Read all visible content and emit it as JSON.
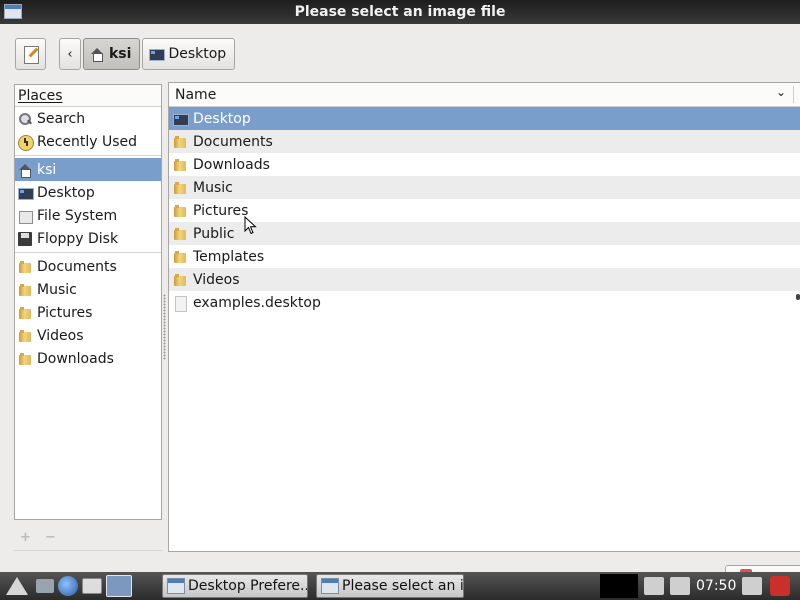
{
  "window": {
    "title": "Please select an image file"
  },
  "toolbar": {
    "edit_icon": "edit-location-icon",
    "back_label": "‹",
    "breadcrumbs": [
      {
        "label": "ksi",
        "icon": "home-icon",
        "active": true
      },
      {
        "label": "Desktop",
        "icon": "desktop-icon",
        "active": false
      }
    ]
  },
  "places": {
    "header": "Places",
    "items": [
      {
        "label": "Search",
        "icon": "search-icon"
      },
      {
        "label": "Recently Used",
        "icon": "recent-icon"
      },
      {
        "label": "ksi",
        "icon": "home-icon",
        "selected": true
      },
      {
        "label": "Desktop",
        "icon": "desktop-icon"
      },
      {
        "label": "File System",
        "icon": "filesystem-icon"
      },
      {
        "label": "Floppy Disk",
        "icon": "floppy-icon"
      }
    ],
    "bookmarks": [
      {
        "label": "Documents",
        "icon": "folder-icon"
      },
      {
        "label": "Music",
        "icon": "folder-icon"
      },
      {
        "label": "Pictures",
        "icon": "folder-icon"
      },
      {
        "label": "Videos",
        "icon": "folder-icon"
      },
      {
        "label": "Downloads",
        "icon": "folder-icon"
      }
    ],
    "add_label": "+",
    "remove_label": "−"
  },
  "files": {
    "column_header": "Name",
    "sort_indicator": "⌄",
    "rows": [
      {
        "name": "Desktop",
        "icon": "desktop-icon",
        "selected": true
      },
      {
        "name": "Documents",
        "icon": "folder-icon"
      },
      {
        "name": "Downloads",
        "icon": "folder-icon"
      },
      {
        "name": "Music",
        "icon": "folder-icon"
      },
      {
        "name": "Pictures",
        "icon": "folder-icon"
      },
      {
        "name": "Public",
        "icon": "folder-icon"
      },
      {
        "name": "Templates",
        "icon": "folder-icon"
      },
      {
        "name": "Videos",
        "icon": "folder-icon"
      },
      {
        "name": "examples.desktop",
        "icon": "file-icon"
      }
    ]
  },
  "taskbar": {
    "tasks": [
      {
        "label": "Desktop Prefere..."
      },
      {
        "label": "Please select an i..."
      }
    ],
    "clock": "07:50"
  },
  "colors": {
    "selection": "#7a9ecb",
    "titlebar": "#2a2a2a",
    "taskbar": "#3a3a3a"
  }
}
